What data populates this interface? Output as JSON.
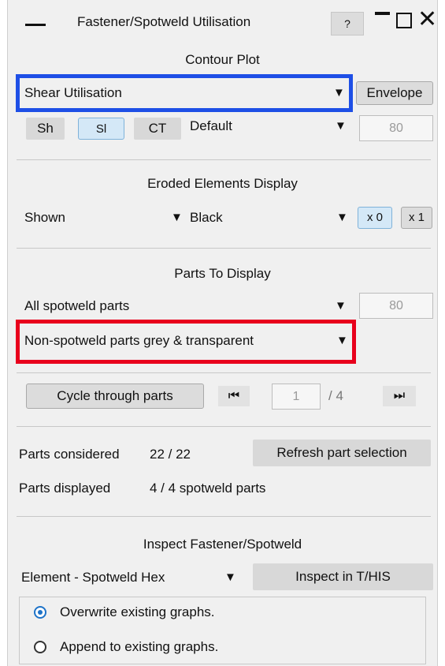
{
  "window": {
    "title": "Fastener/Spotweld Utilisation",
    "help_label": "?"
  },
  "contour": {
    "heading": "Contour Plot",
    "type_value": "Shear Utilisation",
    "envelope_label": "Envelope",
    "sh_label": "Sh",
    "sl_label": "Sl",
    "ct_label": "CT",
    "scale_value": "Default",
    "number_value": "80"
  },
  "eroded": {
    "heading": "Eroded Elements Display",
    "display_value": "Shown",
    "color_value": "Black",
    "x0_label": "x 0",
    "x1_label": "x 1"
  },
  "parts": {
    "heading": "Parts To Display",
    "filter_value": "All spotweld parts",
    "number_value": "80",
    "other_value": "Non-spotweld parts grey & transparent",
    "cycle_label": "Cycle through parts",
    "current_part": "1",
    "total_parts": "/ 4"
  },
  "summary": {
    "considered_label": "Parts considered",
    "considered_value": "22 / 22",
    "refresh_label": "Refresh part selection",
    "displayed_label": "Parts displayed",
    "displayed_value": "4 / 4 spotweld parts"
  },
  "inspect": {
    "heading": "Inspect Fastener/Spotweld",
    "element_value": "Element - Spotweld Hex",
    "inspect_label": "Inspect in T/HIS",
    "overwrite_label": "Overwrite existing graphs.",
    "append_label": "Append to existing graphs.",
    "selected_option": "overwrite"
  },
  "icons": {
    "dropdown": "triangle-down-icon",
    "first": "skip-first-icon",
    "last": "skip-last-icon",
    "close": "close-icon",
    "minimize": "minimize-icon",
    "maximize": "maximize-icon"
  },
  "colors": {
    "highlight_blue": "#1e4fe6",
    "highlight_red": "#e8001c",
    "toggle_active": "#d4e8f7",
    "radio_selected": "#1e73c8"
  }
}
